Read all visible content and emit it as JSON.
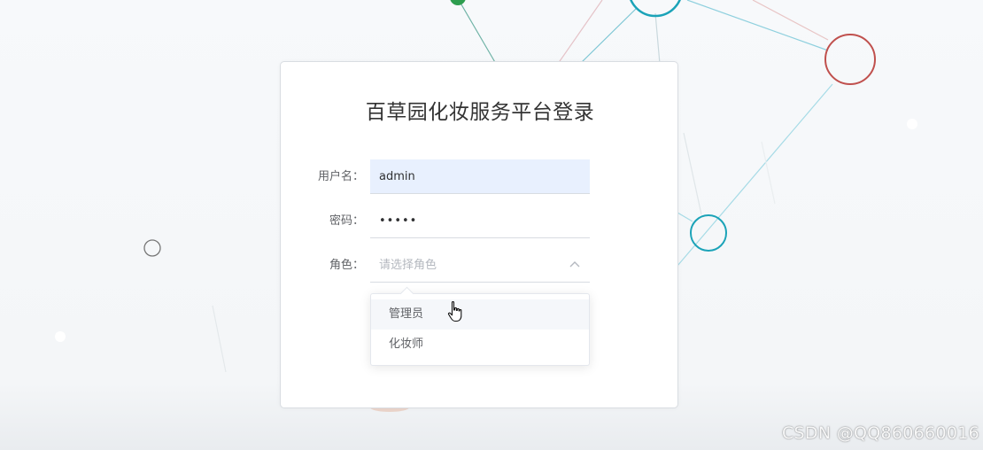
{
  "page": {
    "title": "百草园化妆服务平台登录"
  },
  "form": {
    "username": {
      "label": "用户名：",
      "value": "admin"
    },
    "password": {
      "label": "密码：",
      "value": "•••••"
    },
    "role": {
      "label": "角色：",
      "placeholder": "请选择角色",
      "options": [
        "管理员",
        "化妆师"
      ],
      "hovered_option": "管理员",
      "dropdown_open": true
    }
  },
  "watermark": {
    "text": "CSDN @QQ860660016"
  },
  "colors": {
    "accent_teal": "#1ba3b8",
    "accent_red": "#c0504d",
    "accent_green": "#2e9e4f",
    "autofill_bg": "#e8f0fe"
  },
  "icons": {
    "select_toggle": "chevron-up-icon",
    "pointer": "hand-pointer-icon"
  }
}
